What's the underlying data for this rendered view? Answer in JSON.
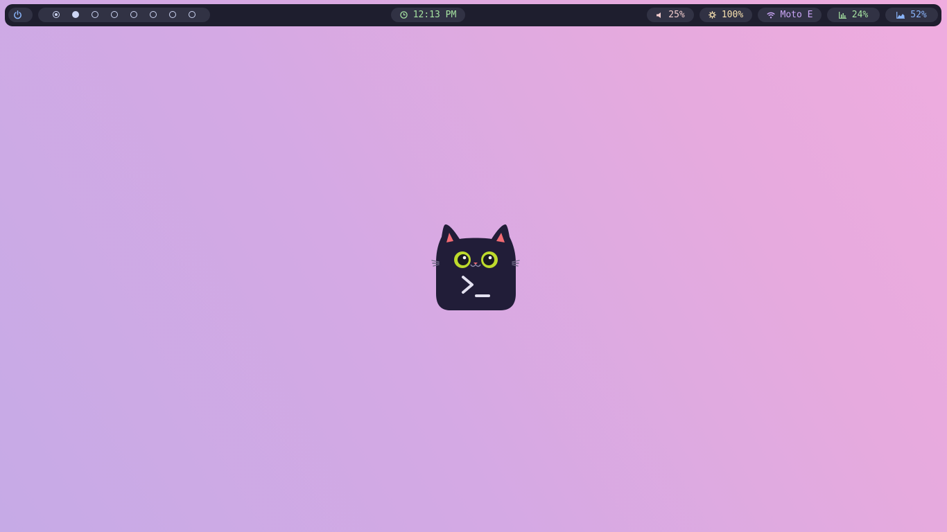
{
  "topbar": {
    "power_icon": "power-icon",
    "workspaces": [
      {
        "state": "home"
      },
      {
        "state": "active"
      },
      {
        "state": "empty"
      },
      {
        "state": "empty"
      },
      {
        "state": "empty"
      },
      {
        "state": "empty"
      },
      {
        "state": "empty"
      },
      {
        "state": "empty"
      }
    ],
    "clock": "12:13 PM",
    "volume": "25%",
    "brightness": "100%",
    "wifi": "Moto E",
    "cpu": "24%",
    "memory": "52%"
  },
  "colors": {
    "bar_bg": "#1e1e2e",
    "pill_bg": "#313244",
    "clock": "#a6e3a1",
    "volume": "#f2cdcd",
    "brightness": "#f9e2af",
    "wifi": "#cba6f7",
    "cpu": "#a6e3a1",
    "memory": "#89b4fa"
  },
  "desktop": {
    "logo_icon": "terminal-cat-icon"
  }
}
